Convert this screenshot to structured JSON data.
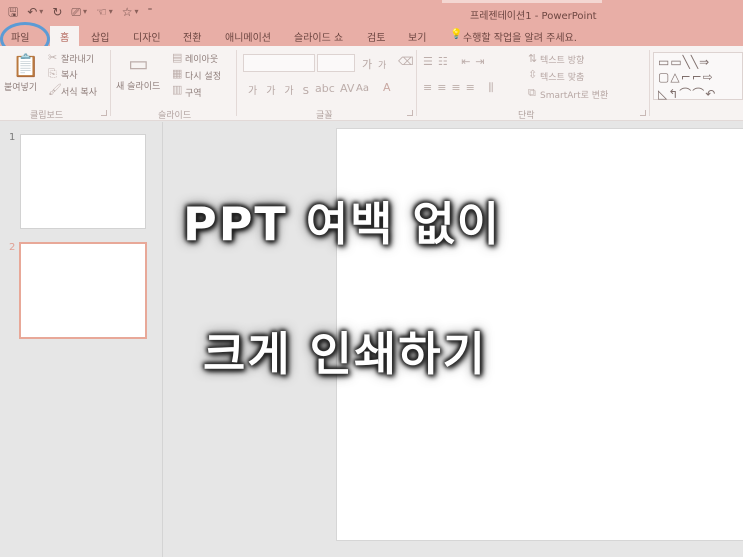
{
  "window": {
    "title": "프레젠테이션1 - PowerPoint"
  },
  "quick_access": {
    "save_icon": "save-icon",
    "undo_icon": "undo-icon",
    "redo_icon": "redo-icon"
  },
  "tabs": [
    {
      "label": "파일"
    },
    {
      "label": "홈"
    },
    {
      "label": "삽입"
    },
    {
      "label": "디자인"
    },
    {
      "label": "전환"
    },
    {
      "label": "애니메이션"
    },
    {
      "label": "슬라이드 쇼"
    },
    {
      "label": "검토"
    },
    {
      "label": "보기"
    }
  ],
  "tell_me": "수행할 작업을 알려 주세요.",
  "ribbon": {
    "clipboard": {
      "paste": "붙여넣기",
      "cut": "잘라내기",
      "copy": "복사",
      "format_painter": "서식 복사",
      "label": "클립보드"
    },
    "slides": {
      "new_slide": "새 슬라이드",
      "layout": "레이아웃",
      "reset": "다시 설정",
      "section": "구역",
      "label": "슬라이드"
    },
    "font": {
      "label": "글꼴",
      "size_up": "가",
      "size_down": "가",
      "case": "Aa"
    },
    "paragraph": {
      "text_direction": "텍스트 방향",
      "align_text": "텍스트 맞춤",
      "smartart": "SmartArt로 변환",
      "label": "단락"
    }
  },
  "slides": [
    {
      "number": "1"
    },
    {
      "number": "2"
    }
  ],
  "overlay": {
    "line1": "PPT 여백 없이",
    "line2": "크게 인쇄하기"
  },
  "colors": {
    "accent": "#e8aea6",
    "highlight_circle": "#5b9bd5",
    "selected_slide": "#e8a898"
  }
}
